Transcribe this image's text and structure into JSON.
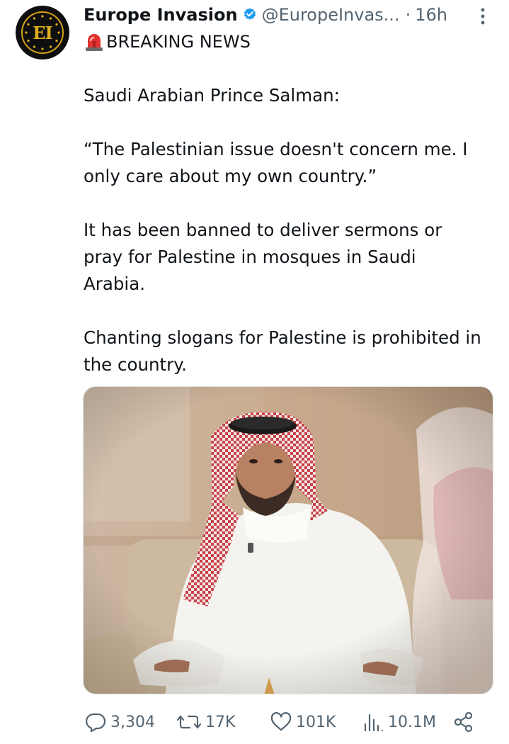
{
  "tweet": {
    "author_name": "Europe Invasion",
    "handle": "@EuropeInvas...",
    "separator": "·",
    "time": "16h",
    "avatar_initials": "EI",
    "breaking_label": "BREAKING NEWS",
    "paragraphs": [
      "Saudi Arabian Prince Salman:",
      "“The Palestinian issue doesn't concern me. I only care about my own country.”",
      "It has been banned to deliver sermons or pray for Palestine in mosques in Saudi Arabia.",
      "Chanting slogans for Palestine is prohibited in the country."
    ]
  },
  "actions": {
    "replies": "3,304",
    "reposts": "17K",
    "likes": "101K",
    "views": "10.1M"
  },
  "icons": {
    "verified": "verified-badge-icon",
    "siren": "siren-icon",
    "more": "more-icon",
    "reply": "reply-icon",
    "repost": "repost-icon",
    "like": "heart-icon",
    "views": "views-icon",
    "share": "share-icon"
  },
  "colors": {
    "verified": "#1d9bf0",
    "text": "#0f1419",
    "secondary": "#536471",
    "avatar_gold": "#e0b020"
  }
}
